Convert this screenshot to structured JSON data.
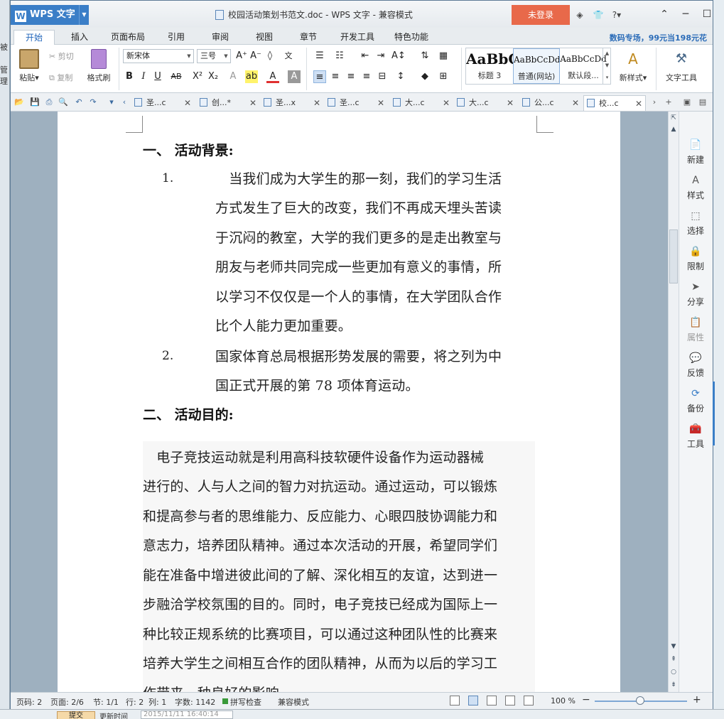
{
  "window": {
    "app_name": "WPS 文字",
    "title": "校园活动策划书范文.doc - WPS 文字 - 兼容模式",
    "login_label": "未登录"
  },
  "background": {
    "left_labels": [
      "被",
      "管理"
    ],
    "bottom_button": "提交",
    "bottom_label": "更新时间",
    "bottom_value": "2015/11/11 16:40:14"
  },
  "ribbon_tabs": [
    "开始",
    "插入",
    "页面布局",
    "引用",
    "审阅",
    "视图",
    "章节",
    "开发工具",
    "特色功能"
  ],
  "active_tab": "开始",
  "promo": "数码专场，99元当198元花",
  "clipboard": {
    "paste": "粘贴",
    "cut": "剪切",
    "copy": "复制",
    "format_painter": "格式刷"
  },
  "font": {
    "family": "新宋体",
    "size": "三号"
  },
  "styles": {
    "items": [
      {
        "sample": "AaBbC",
        "name": "标题 3"
      },
      {
        "sample": "AaBbCcDd",
        "name": "普通(网站)"
      },
      {
        "sample": "AaBbCcDd",
        "name": "默认段..."
      }
    ],
    "new_style": "新样式",
    "text_tools": "文字工具"
  },
  "doc_tabs": [
    {
      "label": "圣...c"
    },
    {
      "label": "创...*"
    },
    {
      "label": "圣...x"
    },
    {
      "label": "圣...c"
    },
    {
      "label": "大...c"
    },
    {
      "label": "大...c"
    },
    {
      "label": "公...c"
    },
    {
      "label": "校...c"
    }
  ],
  "document": {
    "heading1": "一、 活动背景:",
    "list_items": [
      {
        "number": "1.",
        "lines": [
          "　当我们成为大学生的那一刻，我们的学习生活",
          "方式发生了巨大的改变，我们不再成天埋头苦读",
          "于沉闷的教室，大学的我们更多的是走出教室与",
          "朋友与老师共同完成一些更加有意义的事情，所",
          "以学习不仅仅是一个人的事情，在大学团队合作",
          "比个人能力更加重要。"
        ]
      },
      {
        "number": "2.",
        "lines": [
          "国家体育总局根据形势发展的需要，将之列为中",
          "国正式开展的第 78 项体育运动。"
        ]
      }
    ],
    "heading2": "二、 活动目的:",
    "para_lines": [
      "　电子竞技运动就是利用高科技软硬件设备作为运动器械",
      "进行的、人与人之间的智力对抗运动。通过运动，可以锻炼",
      "和提高参与者的思维能力、反应能力、心眼四肢协调能力和",
      "意志力，培养团队精神。通过本次活动的开展，希望同学们",
      "能在准备中增进彼此间的了解、深化相互的友谊，达到进一",
      "步融洽学校氛围的目的。同时，电子竞技已经成为国际上一",
      "种比较正规系统的比赛项目，可以通过这种团队性的比赛来",
      "培养大学生之间相互合作的团队精神，从而为以后的学习工",
      "作带来一种良好的影响。"
    ]
  },
  "task_pane": [
    {
      "icon": "new-doc-icon",
      "label": "新建",
      "enabled": true
    },
    {
      "icon": "style-icon",
      "label": "样式",
      "enabled": true
    },
    {
      "icon": "select-icon",
      "label": "选择",
      "enabled": true
    },
    {
      "icon": "lock-icon",
      "label": "限制",
      "enabled": true
    },
    {
      "icon": "share-icon",
      "label": "分享",
      "enabled": true
    },
    {
      "icon": "properties-icon",
      "label": "属性",
      "enabled": false
    },
    {
      "icon": "feedback-icon",
      "label": "反馈",
      "enabled": true
    },
    {
      "icon": "backup-icon",
      "label": "备份",
      "enabled": true
    },
    {
      "icon": "toolbox-icon",
      "label": "工具",
      "enabled": true
    }
  ],
  "status": {
    "page_num": "页码: 2",
    "pages": "页面: 2/6",
    "section": "节: 1/1",
    "row": "行: 2",
    "col": "列: 1",
    "words": "字数: 1142",
    "spell": "拼写检查",
    "mode": "兼容模式",
    "zoom": "100 %"
  },
  "colors": {
    "accent": "#3a7ec7",
    "login": "#e8694a",
    "promo": "#2b6cb8"
  }
}
